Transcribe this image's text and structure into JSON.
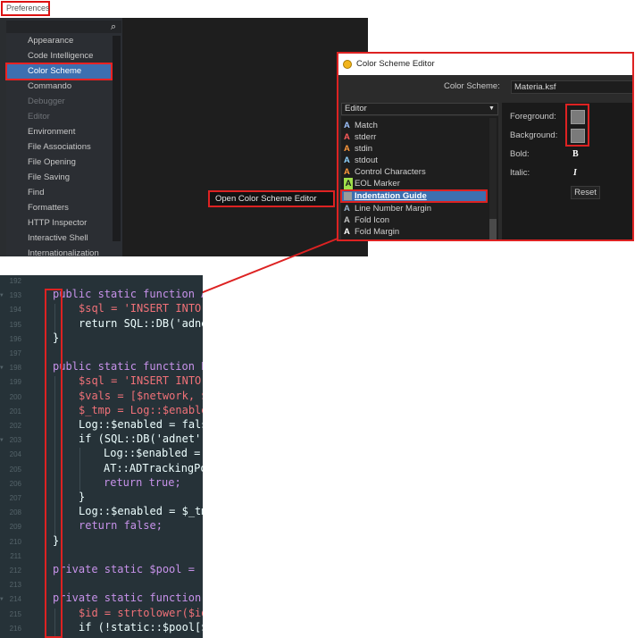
{
  "preferences": {
    "title": "Preferences",
    "items": [
      {
        "label": "Appearance",
        "enabled": true
      },
      {
        "label": "Code Intelligence",
        "enabled": true
      },
      {
        "label": "Color Scheme",
        "enabled": true,
        "selected": true
      },
      {
        "label": "Commando",
        "enabled": true
      },
      {
        "label": "Debugger",
        "enabled": false
      },
      {
        "label": "Editor",
        "enabled": false
      },
      {
        "label": "Environment",
        "enabled": true
      },
      {
        "label": "File Associations",
        "enabled": true
      },
      {
        "label": "File Opening",
        "enabled": true
      },
      {
        "label": "File Saving",
        "enabled": true
      },
      {
        "label": "Find",
        "enabled": true
      },
      {
        "label": "Formatters",
        "enabled": true
      },
      {
        "label": "HTTP Inspector",
        "enabled": true
      },
      {
        "label": "Interactive Shell",
        "enabled": true
      },
      {
        "label": "Internationalization",
        "enabled": true
      }
    ],
    "open_editor_button": "Open Color Scheme Editor"
  },
  "color_scheme_editor": {
    "title": "Color Scheme Editor",
    "scheme_label": "Color Scheme:",
    "scheme_value": "Materia.ksf",
    "category": "Editor",
    "items": [
      {
        "letter": "A",
        "label": "Match",
        "color": "#9ec3ff"
      },
      {
        "letter": "A",
        "label": "stderr",
        "color": "#ff5b5b"
      },
      {
        "letter": "A",
        "label": "stdin",
        "color": "#ff9a3c"
      },
      {
        "letter": "A",
        "label": "stdout",
        "color": "#8fd3ff"
      },
      {
        "letter": "A",
        "label": "Control Characters",
        "color": "#ff9a3c"
      },
      {
        "letter": "A",
        "label": "EOL Marker",
        "color": "#a0e04a"
      },
      {
        "letter": "",
        "label": "Indentation Guide",
        "color": "#9a9a9a",
        "selected": true
      },
      {
        "letter": "A",
        "label": "Line Number Margin",
        "color": "#9ab0c8"
      },
      {
        "letter": "A",
        "label": "Fold Icon",
        "color": "#c0c0c0"
      },
      {
        "letter": "A",
        "label": "Fold Margin",
        "color": "#ffffff"
      }
    ],
    "foreground_label": "Foreground:",
    "background_label": "Background:",
    "bold_label": "Bold:",
    "italic_label": "Italic:",
    "bold_glyph": "B",
    "italic_glyph": "I",
    "reset_label": "Reset"
  },
  "code": {
    "lines": [
      {
        "n": "192",
        "text": ""
      },
      {
        "n": "193",
        "text": "public static function A"
      },
      {
        "n": "194",
        "text": "$sql = 'INSERT INTO"
      },
      {
        "n": "195",
        "text": "return SQL::DB('adne"
      },
      {
        "n": "196",
        "text": "}"
      },
      {
        "n": "197",
        "text": ""
      },
      {
        "n": "198",
        "text": "public static function P"
      },
      {
        "n": "199",
        "text": "$sql = 'INSERT INTO"
      },
      {
        "n": "200",
        "text": "$vals = [$network, $"
      },
      {
        "n": "201",
        "text": "$_tmp = Log::$enable"
      },
      {
        "n": "202",
        "text": "Log::$enabled = fals"
      },
      {
        "n": "203",
        "text": "if (SQL::DB('adnet')"
      },
      {
        "n": "204",
        "text": "Log::$enabled ="
      },
      {
        "n": "205",
        "text": "AT::ADTrackingPo"
      },
      {
        "n": "206",
        "text": "return true;"
      },
      {
        "n": "207",
        "text": "}"
      },
      {
        "n": "208",
        "text": "Log::$enabled = $_tm"
      },
      {
        "n": "209",
        "text": "return false;"
      },
      {
        "n": "210",
        "text": "}"
      },
      {
        "n": "211",
        "text": ""
      },
      {
        "n": "212",
        "text": "private static $pool = ["
      },
      {
        "n": "213",
        "text": ""
      },
      {
        "n": "214",
        "text": "private static function"
      },
      {
        "n": "215",
        "text": "$id = strtolower($id"
      },
      {
        "n": "216",
        "text": "if (!static::$pool[$"
      }
    ]
  },
  "colors": {
    "highlight": "#dd2222",
    "selection": "#3d6fb0",
    "code_background": "#263238"
  }
}
